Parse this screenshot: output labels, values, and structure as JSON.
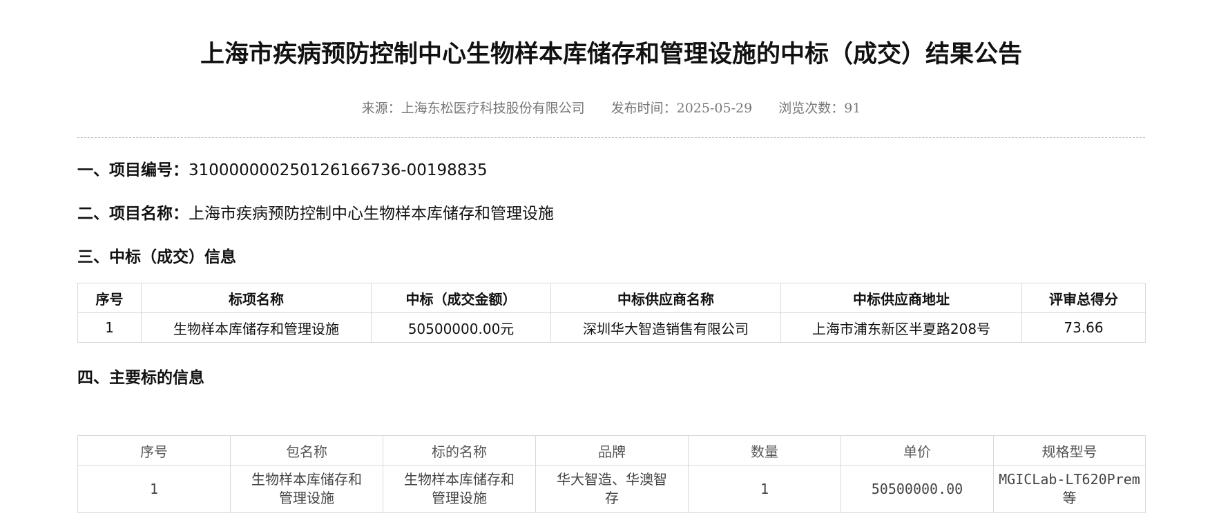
{
  "title": "上海市疾病预防控制中心生物样本库储存和管理设施的中标（成交）结果公告",
  "meta": {
    "source": "来源：上海东松医疗科技股份有限公司",
    "publish_time": "发布时间：2025-05-29",
    "views": "浏览次数：91"
  },
  "sections": {
    "project_no": {
      "heading": "一、项目编号：",
      "value": "310000000250126166736-00198835"
    },
    "project_name": {
      "heading": "二、项目名称：",
      "value": "上海市疾病预防控制中心生物样本库储存和管理设施"
    },
    "award_info": {
      "heading": "三、中标（成交）信息"
    },
    "main_items": {
      "heading": "四、主要标的信息"
    }
  },
  "award_table": {
    "headers": [
      "序号",
      "标项名称",
      "中标（成交金额）",
      "中标供应商名称",
      "中标供应商地址",
      "评审总得分"
    ],
    "rows": [
      [
        "1",
        "生物样本库储存和管理设施",
        "50500000.00元",
        "深圳华大智造销售有限公司",
        "上海市浦东新区半夏路208号",
        "73.66"
      ]
    ]
  },
  "items_table": {
    "headers": [
      "序号",
      "包名称",
      "标的名称",
      "品牌",
      "数量",
      "单价",
      "规格型号"
    ],
    "rows": [
      [
        "1",
        "生物样本库储存和管理设施",
        "生物样本库储存和管理设施",
        "华大智造、华澳智存",
        "1",
        "50500000.00",
        "MGICLab-LT620Prem等"
      ]
    ]
  }
}
